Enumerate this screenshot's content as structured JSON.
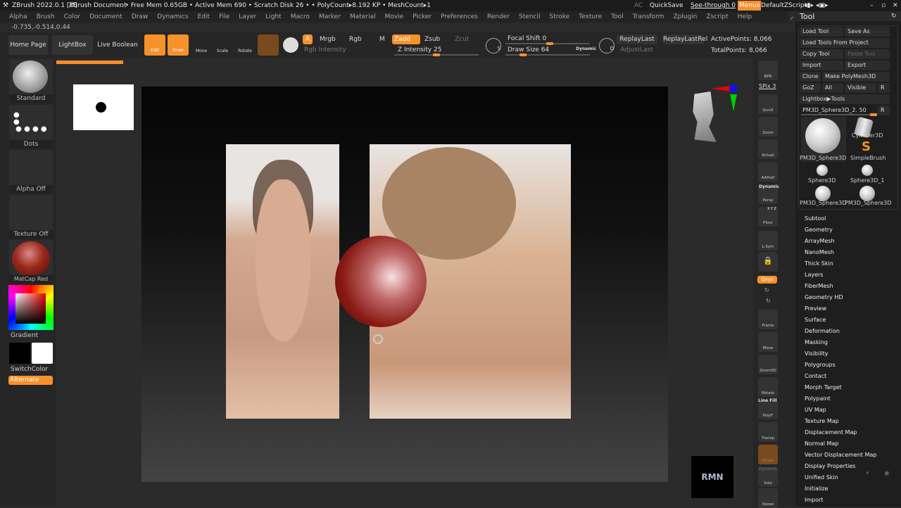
{
  "titlebar": {
    "app": "ZBrush 2022.0.1 [M]",
    "document": "ZBrush Document",
    "stats": ". • Free Mem 0.65GB • Active Mem 690 • Scratch Disk 26 •  • PolyCount▸8.192 KP  • MeshCount▸1",
    "ac": "AC",
    "quicksave": "QuickSave",
    "see_through": "See-through  0",
    "menus": "Menus",
    "script": "DefaultZScript"
  },
  "menus": [
    "Alpha",
    "Brush",
    "Color",
    "Document",
    "Draw",
    "Dynamics",
    "Edit",
    "File",
    "Layer",
    "Light",
    "Macro",
    "Marker",
    "Material",
    "Movie",
    "Picker",
    "Preferences",
    "Render",
    "Stencil",
    "Stroke",
    "Texture",
    "Tool",
    "Transform",
    "Zplugin",
    "Zscript",
    "Help"
  ],
  "coords": "-0.735,-0.514,0.44",
  "toolbar": {
    "home": "Home Page",
    "lightbox": "LightBox",
    "live_boolean": "Live Boolean",
    "edit": "Edit",
    "draw": "Draw",
    "move": "Move",
    "scale": "Scale",
    "rotate": "Rotate",
    "a": "A",
    "mrgb": "Mrgb",
    "rgb": "Rgb",
    "m": "M",
    "zadd": "Zadd",
    "zsub": "Zsub",
    "zcut": "Zcut",
    "rgb_intensity": "Rgb Intensity",
    "z_intensity": "Z Intensity 25",
    "focal_shift": "Focal Shift 0",
    "draw_size": "Draw Size 64",
    "dynamic": "Dynamic",
    "replay_last": "ReplayLast",
    "replay_last_rel": "ReplayLastRel",
    "adjust_last": "AdjustLast",
    "active_points": "ActivePoints: 8,066",
    "total_points": "TotalPoints: 8,066",
    "s": "S",
    "d": "D"
  },
  "values": {
    "z_intensity": 25,
    "focal_shift": 0,
    "draw_size": 64,
    "see_through": 0,
    "spix": 3,
    "tool_slider": 50
  },
  "left": {
    "brush": "Standard",
    "stroke": "Dots",
    "alpha": "Alpha Off",
    "texture": "Texture Off",
    "material": "MatCap Red Wax",
    "gradient": "Gradient",
    "switch_color": "SwitchColor",
    "alternate": "Alternate"
  },
  "shelf": [
    "BPR",
    "SPix 3",
    "Scroll",
    "Zoom",
    "Actual",
    "AAHalf",
    "Persp",
    "Floor",
    "L.Sym",
    "",
    "Qxyz",
    "",
    "",
    "Frame",
    "Move",
    "Zoom3D",
    "Rotate",
    "PolyF",
    "Transp",
    "Ghost",
    "Solo",
    "Xpose"
  ],
  "shelf_extra": {
    "dynamic": "Dynamic",
    "line_fill": "Line Fill",
    "dynamic2": "Dynamic",
    "xyz": "X Y Z"
  },
  "tool": {
    "title": "Tool",
    "load_tool": "Load Tool",
    "save_as": "Save As",
    "load_from_project": "Load Tools From Project",
    "copy_tool": "Copy Tool",
    "paste_tool": "Paste Tool",
    "import": "Import",
    "export": "Export",
    "clone": "Clone",
    "make_polymesh": "Make PolyMesh3D",
    "goz": "GoZ",
    "all": "All",
    "visible": "Visible",
    "r": "R",
    "lightbox_tools": "Lightbox▶Tools",
    "current": "PM3D_Sphere3D_2. 50",
    "thumbs": [
      "PM3D_Sphere3D",
      "Cylinder3D",
      "SimpleBrush",
      "Sphere3D",
      "Sphere3D_1",
      "PM3D_Sphere3D",
      "PM3D_Sphere3D"
    ],
    "subpalettes": [
      "Subtool",
      "Geometry",
      "ArrayMesh",
      "NanoMesh",
      "Thick Skin",
      "Layers",
      "FiberMesh",
      "Geometry HD",
      "Preview",
      "Surface",
      "Deformation",
      "Masking",
      "Visibility",
      "Polygroups",
      "Contact",
      "Morph Target",
      "Polypaint",
      "UV Map",
      "Texture Map",
      "Displacement Map",
      "Normal Map",
      "Vector Displacement Map",
      "Display Properties",
      "Unified Skin",
      "Initialize",
      "Import"
    ]
  },
  "logo": "RMN",
  "colors": {
    "accent": "#f7912a",
    "background": "#2a2a2a"
  }
}
